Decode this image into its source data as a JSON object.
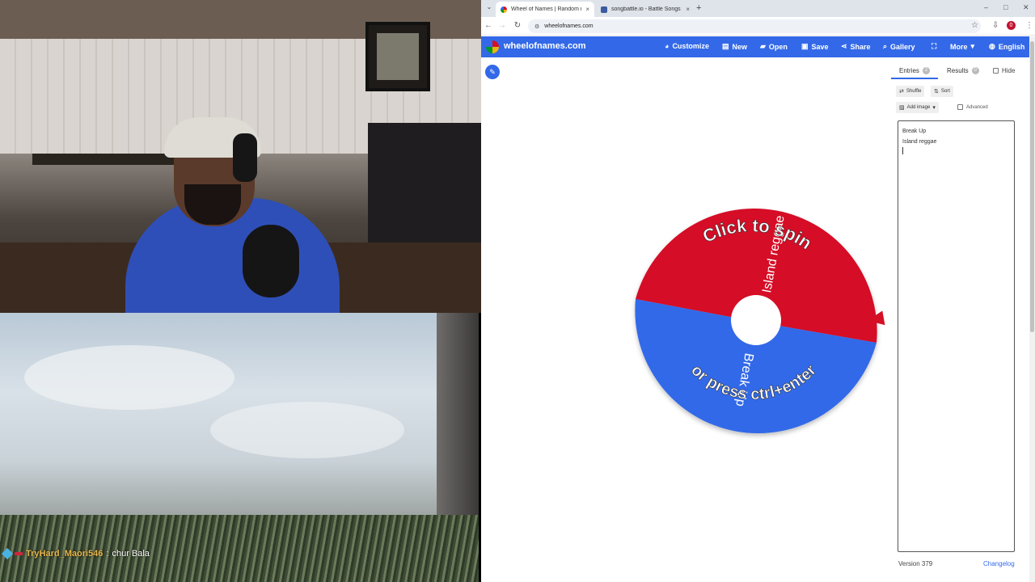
{
  "stream": {
    "chat_user": "TryHard_Maori546",
    "chat_separator": ":",
    "chat_message": "chur Bala"
  },
  "browser": {
    "tabs": [
      {
        "title": "Wheel of Names | Random nar",
        "active": true
      },
      {
        "title": "songbattle.io - Battle Songs ag",
        "active": false
      }
    ],
    "new_tab": "+",
    "url": "wheelofnames.com",
    "profile_initial": "0"
  },
  "app": {
    "brand": "wheelofnames.com",
    "menu": [
      {
        "icon": "palette-icon",
        "label": "Customize"
      },
      {
        "icon": "new-file-icon",
        "label": "New"
      },
      {
        "icon": "folder-icon",
        "label": "Open"
      },
      {
        "icon": "save-icon",
        "label": "Save"
      },
      {
        "icon": "share-icon",
        "label": "Share"
      },
      {
        "icon": "search-icon",
        "label": "Gallery"
      },
      {
        "icon": "fullscreen-icon",
        "label": ""
      },
      {
        "icon": "chevron-down-icon",
        "label": "More"
      },
      {
        "icon": "globe-icon",
        "label": "English"
      }
    ],
    "accent_color": "#3369e8"
  },
  "wheel": {
    "center_text_top": "Click to spin",
    "center_text_bottom": "or press ctrl+enter",
    "segments": [
      {
        "label": "Island reggae",
        "color": "#d50f25"
      },
      {
        "label": "Break Up",
        "color": "#3369e8"
      }
    ]
  },
  "sidebar": {
    "tab_entries": "Entries",
    "entries_count": "2",
    "tab_results": "Results",
    "results_count": "0",
    "hide_label": "Hide",
    "shuffle_label": "Shuffle",
    "sort_label": "Sort",
    "add_image_label": "Add image",
    "advanced_label": "Advanced",
    "entries": [
      "Break Up",
      "Island reggae"
    ],
    "version": "Version 379",
    "changelog": "Changelog"
  }
}
